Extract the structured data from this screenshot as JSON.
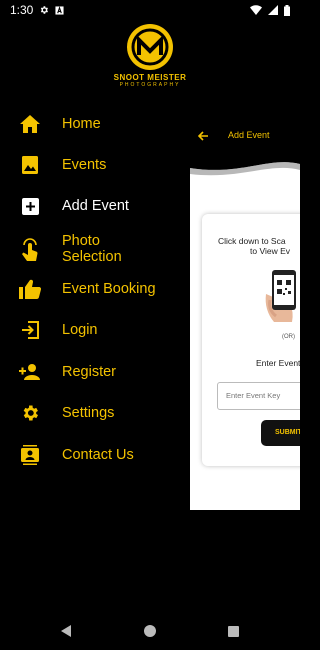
{
  "status_bar": {
    "time": "1:30",
    "icons_left": [
      "gear-icon",
      "a-box-icon"
    ],
    "icons_right": [
      "wifi-icon",
      "cell-signal-icon",
      "battery-icon"
    ]
  },
  "logo": {
    "title": "SNOOT MEISTER",
    "subtitle": "PHOTOGRAPHY"
  },
  "menu": {
    "items": [
      {
        "label": "Home",
        "icon": "home-icon",
        "active": false
      },
      {
        "label": "Events",
        "icon": "image-icon",
        "active": false
      },
      {
        "label": "Add Event",
        "icon": "add-box-icon",
        "active": true
      },
      {
        "label": "Photo\nSelection",
        "line1": "Photo",
        "line2": "Selection",
        "icon": "touch-icon",
        "active": false
      },
      {
        "label": "Event Booking",
        "icon": "thumbs-up-icon",
        "active": false
      },
      {
        "label": "Login",
        "icon": "login-icon",
        "active": false
      },
      {
        "label": "Register",
        "icon": "add-person-icon",
        "active": false
      },
      {
        "label": "Settings",
        "icon": "gear-icon",
        "active": false
      },
      {
        "label": "Contact Us",
        "icon": "contact-card-icon",
        "active": false
      }
    ]
  },
  "screen": {
    "title": "Add Event",
    "scan_line1": "Click down to Sca",
    "scan_line2": "to View Ev",
    "or_text": "(OR)",
    "enter_label": "Enter Event",
    "input_placeholder": "Enter Event Key",
    "submit_label": "SUBMIT"
  },
  "colors": {
    "accent": "#f3c200",
    "background": "#000000",
    "surface": "#ffffff"
  },
  "nav_bar": {
    "icons": [
      "back-triangle-icon",
      "home-circle-icon",
      "recents-square-icon"
    ]
  }
}
